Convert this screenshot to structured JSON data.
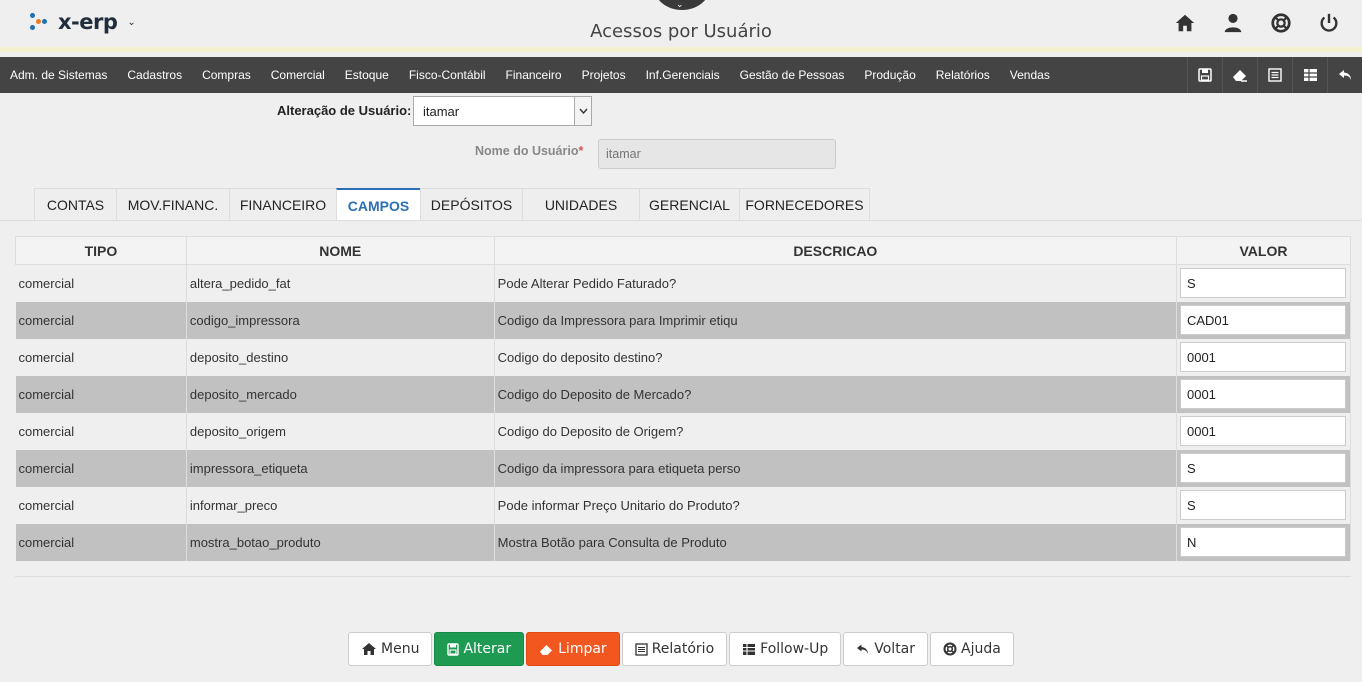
{
  "header": {
    "logo_text": "x-erp",
    "title": "Acessos por Usuário",
    "icons": [
      "home-icon",
      "user-icon",
      "lifebuoy-icon",
      "power-icon"
    ]
  },
  "menu": {
    "items": [
      "Adm. de Sistemas",
      "Cadastros",
      "Compras",
      "Comercial",
      "Estoque",
      "Fisco-Contábil",
      "Financeiro",
      "Projetos",
      "Inf.Gerenciais",
      "Gestão de Pessoas",
      "Produção",
      "Relatórios",
      "Vendas"
    ],
    "tools": [
      "save-icon",
      "eraser-icon",
      "list-icon",
      "table-icon",
      "undo-icon"
    ]
  },
  "form": {
    "user_label": "Alteração de Usuário:",
    "user_value": "itamar",
    "name_label": "Nome do Usuário",
    "required_mark": "*",
    "name_placeholder": "itamar"
  },
  "tabs": [
    {
      "label": "CONTAS",
      "active": false
    },
    {
      "label": "MOV.FINANC.",
      "active": false
    },
    {
      "label": "FINANCEIRO",
      "active": false
    },
    {
      "label": "CAMPOS",
      "active": true
    },
    {
      "label": "DEPÓSITOS",
      "active": false
    },
    {
      "label": "UNIDADES",
      "active": false
    },
    {
      "label": "GERENCIAL",
      "active": false
    },
    {
      "label": "FORNECEDORES",
      "active": false
    }
  ],
  "table": {
    "headers": [
      "TIPO",
      "NOME",
      "DESCRICAO",
      "VALOR"
    ],
    "rows": [
      {
        "tipo": "comercial",
        "nome": "altera_pedido_fat",
        "descricao": "Pode Alterar Pedido Faturado?",
        "valor": "S"
      },
      {
        "tipo": "comercial",
        "nome": "codigo_impressora",
        "descricao": "Codigo da Impressora para Imprimir etiqu",
        "valor": "CAD01"
      },
      {
        "tipo": "comercial",
        "nome": "deposito_destino",
        "descricao": "Codigo do deposito destino?",
        "valor": "0001"
      },
      {
        "tipo": "comercial",
        "nome": "deposito_mercado",
        "descricao": "Codigo do Deposito de Mercado?",
        "valor": "0001"
      },
      {
        "tipo": "comercial",
        "nome": "deposito_origem",
        "descricao": "Codigo do Deposito de Origem?",
        "valor": "0001"
      },
      {
        "tipo": "comercial",
        "nome": "impressora_etiqueta",
        "descricao": "Codigo da impressora para etiqueta perso",
        "valor": "S"
      },
      {
        "tipo": "comercial",
        "nome": "informar_preco",
        "descricao": "Pode informar Preço Unitario do Produto?",
        "valor": "S"
      },
      {
        "tipo": "comercial",
        "nome": "mostra_botao_produto",
        "descricao": "Mostra Botão para Consulta de Produto",
        "valor": "N"
      }
    ]
  },
  "buttons": {
    "menu": "Menu",
    "alterar": "Alterar",
    "limpar": "Limpar",
    "relatorio": "Relatório",
    "followup": "Follow-Up",
    "voltar": "Voltar",
    "ajuda": "Ajuda"
  },
  "colors": {
    "accent": "#2a6fb3",
    "menubar": "#444444",
    "green": "#1e9a52",
    "orange": "#f2571f",
    "logo_orange": "#f07a1a",
    "logo_blue": "#1f6fb2"
  }
}
